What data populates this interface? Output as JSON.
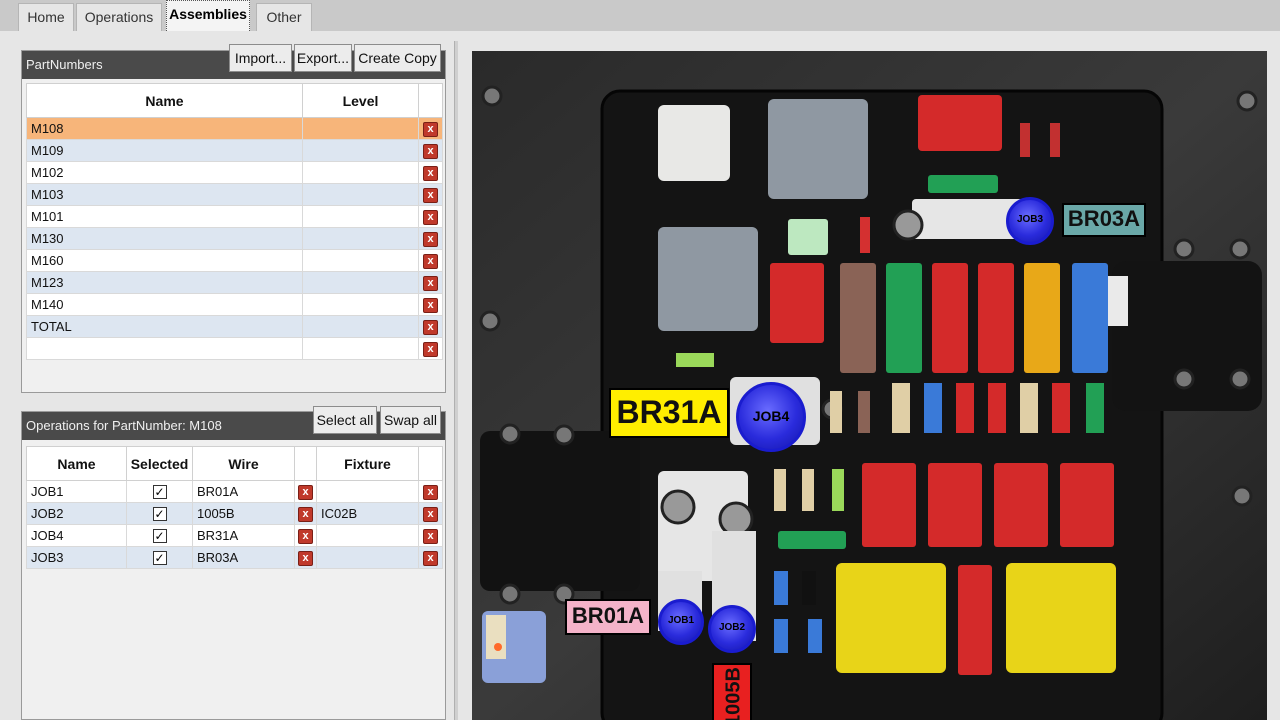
{
  "tabs": [
    "Home",
    "Operations",
    "Assemblies",
    "Other"
  ],
  "partnumbers": {
    "title": "PartNumbers",
    "buttons": {
      "import": "Import...",
      "export": "Export...",
      "copy": "Create Copy"
    },
    "columns": {
      "name": "Name",
      "level": "Level"
    },
    "rows": [
      {
        "name": "M108",
        "level": ""
      },
      {
        "name": "M109",
        "level": ""
      },
      {
        "name": "M102",
        "level": ""
      },
      {
        "name": "M103",
        "level": ""
      },
      {
        "name": "M101",
        "level": ""
      },
      {
        "name": "M130",
        "level": ""
      },
      {
        "name": "M160",
        "level": ""
      },
      {
        "name": "M123",
        "level": ""
      },
      {
        "name": "M140",
        "level": ""
      },
      {
        "name": "TOTAL",
        "level": ""
      },
      {
        "name": "",
        "level": ""
      }
    ],
    "delete_glyph": "x"
  },
  "operations": {
    "title": "Operations for PartNumber: M108",
    "buttons": {
      "select_all": "Select all",
      "swap_all": "Swap all"
    },
    "columns": {
      "name": "Name",
      "selected": "Selected",
      "wire": "Wire",
      "fixture": "Fixture"
    },
    "rows": [
      {
        "name": "JOB1",
        "selected": "✓",
        "wire": "BR01A",
        "fixture": ""
      },
      {
        "name": "JOB2",
        "selected": "✓",
        "wire": "1005B",
        "fixture": "IC02B"
      },
      {
        "name": "JOB4",
        "selected": "✓",
        "wire": "BR31A",
        "fixture": ""
      },
      {
        "name": "JOB3",
        "selected": "✓",
        "wire": "BR03A",
        "fixture": ""
      }
    ]
  },
  "photo": {
    "labels": {
      "br31a": "BR31A",
      "br03a": "BR03A",
      "br01a": "BR01A",
      "b1005": "1005B"
    },
    "jobs": {
      "job1": "JOB1",
      "job2": "JOB2",
      "job3": "JOB3",
      "job4": "JOB4"
    },
    "colors": {
      "br31a": "#ffee00",
      "br03a": "#6aa8a8",
      "br01a": "#f4b3c9",
      "b1005": "#e82020",
      "job": "#2a2bdc"
    }
  }
}
